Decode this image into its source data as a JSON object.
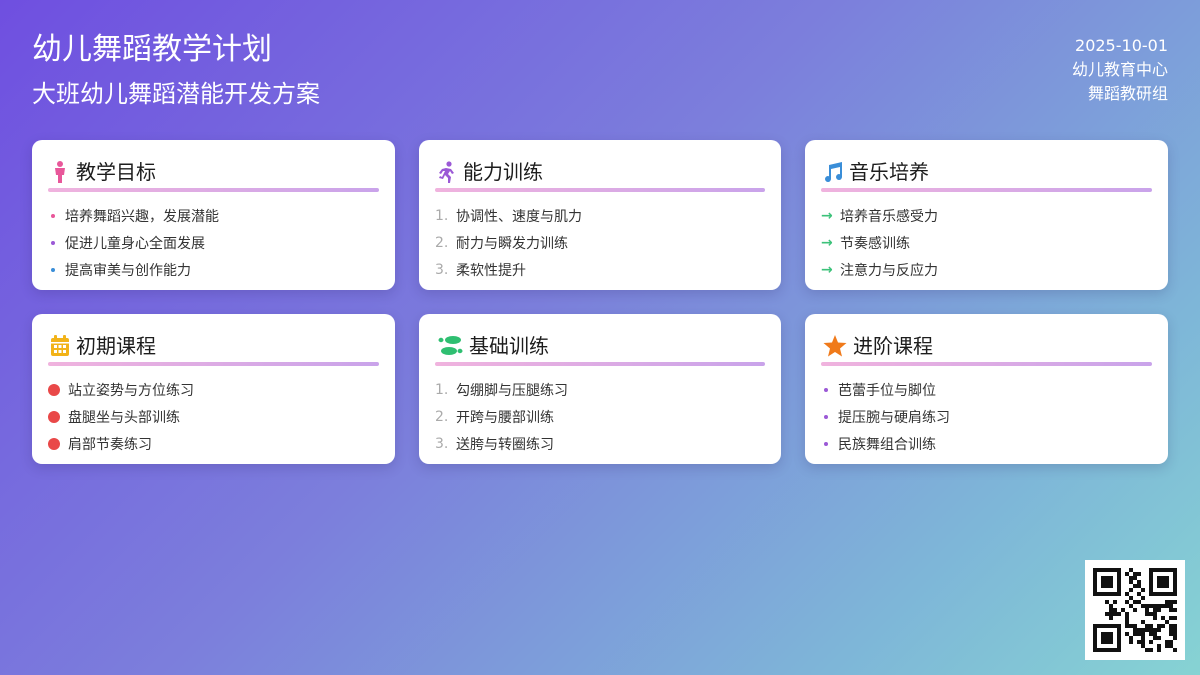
{
  "header": {
    "title": "幼儿舞蹈教学计划",
    "subtitle": "大班幼儿舞蹈潜能开发方案",
    "date": "2025-10-01",
    "org": "幼儿教育中心",
    "group": "舞蹈教研组"
  },
  "cards": [
    {
      "title": "教学目标",
      "icon": "child-icon",
      "icon_color": "#e8579a",
      "items": [
        "培养舞蹈兴趣，发展潜能",
        "促进儿童身心全面发展",
        "提高审美与创作能力"
      ],
      "dot_colors": [
        "#e8579a",
        "#9b59d6",
        "#3a8ed8"
      ]
    },
    {
      "title": "能力训练",
      "icon": "running-icon",
      "icon_color": "#9b59d6",
      "numbers": [
        "1.",
        "2.",
        "3."
      ],
      "items": [
        "协调性、速度与肌力",
        "耐力与瞬发力训练",
        "柔软性提升"
      ]
    },
    {
      "title": "音乐培养",
      "icon": "music-note-icon",
      "icon_color": "#3a8ed8",
      "arrow": "→",
      "items": [
        "培养音乐感受力",
        "节奏感训练",
        "注意力与反应力"
      ]
    },
    {
      "title": "初期课程",
      "icon": "calendar-icon",
      "icon_color": "#f2b318",
      "items": [
        "站立姿势与方位练习",
        "盘腿坐与头部训练",
        "肩部节奏练习"
      ]
    },
    {
      "title": "基础训练",
      "icon": "footprints-icon",
      "icon_color": "#2fbf71",
      "numbers": [
        "1.",
        "2.",
        "3."
      ],
      "items": [
        "勾绷脚与压腿练习",
        "开跨与腰部训练",
        "送胯与转圈练习"
      ]
    },
    {
      "title": "进阶课程",
      "icon": "star-icon",
      "icon_color": "#f07a1a",
      "items": [
        "芭蕾手位与脚位",
        "提压腕与硬肩练习",
        "民族舞组合训练"
      ]
    }
  ]
}
